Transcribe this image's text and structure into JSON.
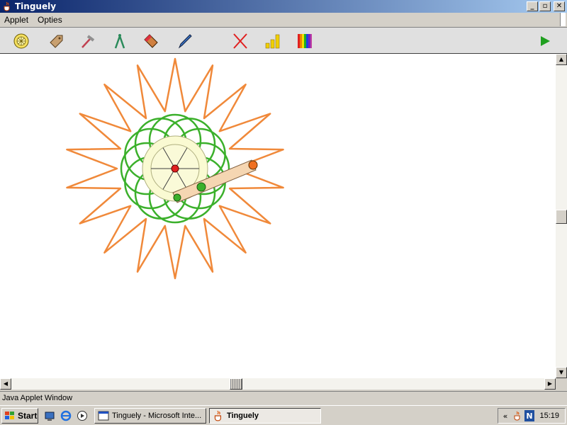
{
  "window": {
    "title": "Tinguely",
    "minimize": "_",
    "restore": "▫",
    "close": "✕"
  },
  "menu": {
    "items": [
      "Applet",
      "Opties"
    ]
  },
  "toolbar": {
    "tools": [
      {
        "name": "wheel-tool-icon"
      },
      {
        "name": "tag-tool-icon"
      },
      {
        "name": "hammer-tool-icon"
      },
      {
        "name": "compass-tool-icon"
      },
      {
        "name": "eraser-tool-icon"
      },
      {
        "name": "pen-tool-icon"
      },
      {
        "name": "delete-icon"
      },
      {
        "name": "speed-bars-icon"
      },
      {
        "name": "color-palette-icon"
      },
      {
        "name": "play-icon"
      }
    ]
  },
  "colors": {
    "orange_curve": "#f0893a",
    "green_curve": "#3bb02b",
    "wheel_fill": "#fafad2",
    "arm_fill": "#f5d6b2",
    "hub_red": "#e02020"
  },
  "status": {
    "text": "Java Applet Window"
  },
  "taskbar": {
    "start_label": "Start",
    "tasks": [
      {
        "label": "Tinguely - Microsoft Inte..."
      },
      {
        "label": "Tinguely"
      }
    ],
    "tray_arrow": "«",
    "tray_letter": "N",
    "clock": "15:19"
  }
}
